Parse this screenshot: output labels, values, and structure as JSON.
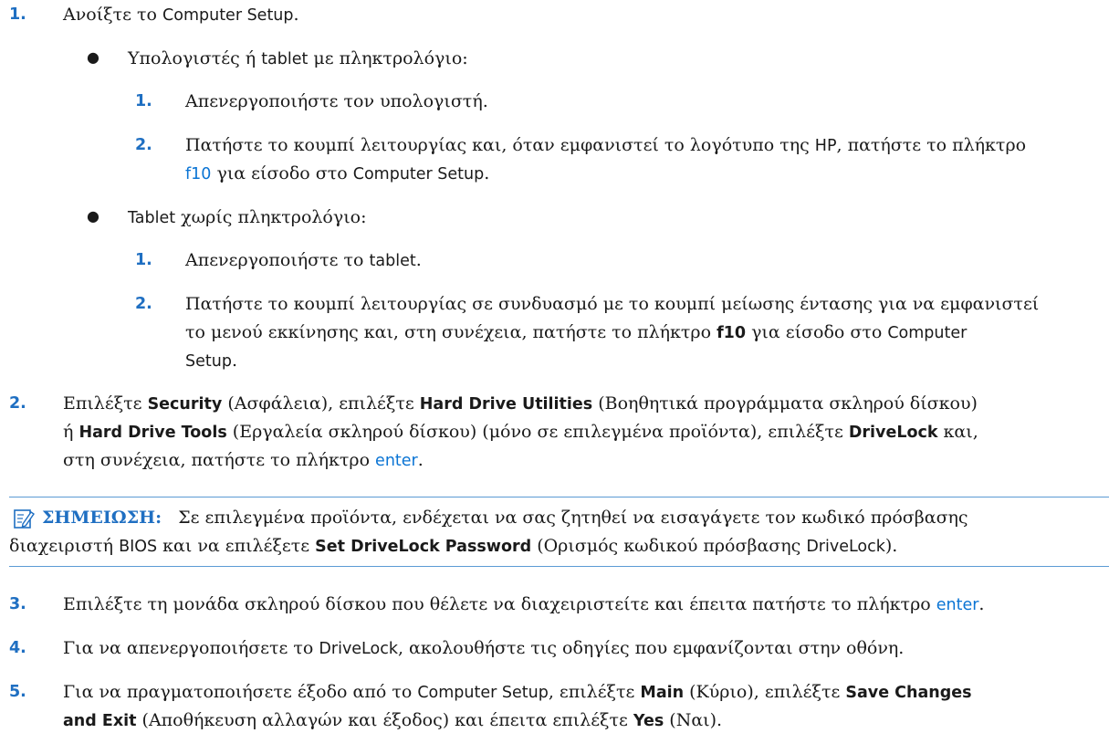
{
  "step1": {
    "num": "1.",
    "text_a": "Ανοίξτε το ",
    "text_b": "Computer Setup",
    "text_c": "."
  },
  "bullet_keyboard": {
    "text_a": "Υπολογιστές ή ",
    "text_b": "tablet",
    "text_c": " με πληκτρολόγιο:",
    "sub1": {
      "num": "1.",
      "text": "Απενεργοποιήστε τον υπολογιστή."
    },
    "sub2": {
      "num": "2.",
      "line1_a": "Πατήστε το κουμπί λειτουργίας και, όταν εμφανιστεί το λογότυπο της ",
      "line1_b": "HP",
      "line1_c": ", πατήστε το πλήκτρο",
      "key": "f10",
      "line2_a": " για είσοδο στο ",
      "line2_b": "Computer Setup",
      "line2_c": "."
    }
  },
  "bullet_tablet": {
    "text_a": "Tablet",
    "text_b": " χωρίς πληκτρολόγιο:",
    "sub1": {
      "num": "1.",
      "text_a": "Απενεργοποιήστε το ",
      "text_b": "tablet",
      "text_c": "."
    },
    "sub2": {
      "num": "2.",
      "line1": "Πατήστε το κουμπί λειτουργίας σε συνδυασμό με το κουμπί μείωσης έντασης για να εμφανιστεί",
      "line2_a": "το μενού εκκίνησης και, στη συνέχεια, πατήστε το πλήκτρο ",
      "key": "f10",
      "line2_b": " για είσοδο στο ",
      "line2_c": "Computer",
      "line3_a": "Setup",
      "line3_b": "."
    }
  },
  "step2": {
    "num": "2.",
    "l1_a": "Επιλέξτε ",
    "l1_b": "Security",
    "l1_c": " (Ασφάλεια), επιλέξτε ",
    "l1_d": "Hard Drive Utilities",
    "l1_e": " (Βοηθητικά προγράμματα σκληρού δίσκου)",
    "l2_a": "ή ",
    "l2_b": "Hard Drive Tools",
    "l2_c": " (Εργαλεία σκληρού δίσκου) (μόνο σε επιλεγμένα προϊόντα), επιλέξτε ",
    "l2_d": "DriveLock",
    "l2_e": " και,",
    "l3_a": "στη συνέχεια, πατήστε το πλήκτρο ",
    "l3_key": "enter",
    "l3_b": "."
  },
  "note": {
    "label": "ΣΗΜΕΙΩΣΗ:",
    "l1": "Σε επιλεγμένα προϊόντα, ενδέχεται να σας ζητηθεί να εισαγάγετε τον κωδικό πρόσβασης",
    "l2_a": "διαχειριστή ",
    "l2_b": "BIOS",
    "l2_c": " και να επιλέξετε ",
    "l2_d": "Set DriveLock Password",
    "l2_e": " (Ορισμός κωδικού πρόσβασης ",
    "l2_f": "DriveLock",
    "l2_g": ")."
  },
  "step3": {
    "num": "3.",
    "text_a": "Επιλέξτε τη μονάδα σκληρού δίσκου που θέλετε να διαχειριστείτε και έπειτα πατήστε το πλήκτρο ",
    "key": "enter",
    "text_b": "."
  },
  "step4": {
    "num": "4.",
    "text_a": "Για να απενεργοποιήσετε το ",
    "text_b": "DriveLock",
    "text_c": ", ακολουθήστε τις οδηγίες που εμφανίζονται στην οθόνη."
  },
  "step5": {
    "num": "5.",
    "l1_a": "Για να πραγματοποιήσετε έξοδο από το ",
    "l1_b": "Computer Setup",
    "l1_c": ", επιλέξτε ",
    "l1_d": "Main",
    "l1_e": " (Κύριο), επιλέξτε ",
    "l1_f": "Save Changes",
    "l2_a": "and Exit",
    "l2_b": " (Αποθήκευση αλλαγών και έξοδος) και έπειτα επιλέξτε ",
    "l2_c": "Yes",
    "l2_d": " (Ναι)."
  },
  "colors": {
    "accent": "#1f6fc2",
    "link": "#0a74d4",
    "rule": "#5b9bd5"
  },
  "icons": {
    "note": "note-pencil-icon",
    "bullet": "bullet-dot-icon"
  }
}
